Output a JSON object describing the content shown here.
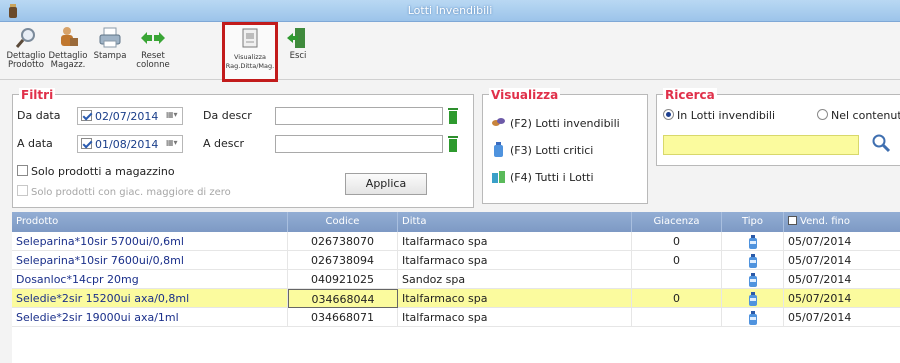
{
  "window": {
    "title": "Lotti Invendibili"
  },
  "toolbar": {
    "buttons": [
      {
        "line1": "Dettaglio",
        "line2": "Prodotto",
        "icon": "search-magnifier-icon"
      },
      {
        "line1": "Dettaglio",
        "line2": "Magazz.",
        "icon": "warehouse-worker-icon"
      },
      {
        "line1": "Stampa",
        "line2": "",
        "icon": "printer-icon"
      },
      {
        "line1": "Reset",
        "line2": "colonne",
        "icon": "reset-arrows-icon"
      },
      {
        "line1": "Visualizza",
        "line2": "Rag.Ditta/Mag.",
        "icon": "view-document-icon"
      },
      {
        "line1": "Esci",
        "line2": "",
        "icon": "exit-door-icon"
      }
    ]
  },
  "filtri": {
    "title": "Filtri",
    "da_data_label": "Da data",
    "da_data_value": "02/07/2014",
    "a_data_label": "A data",
    "a_data_value": "01/08/2014",
    "da_descr_label": "Da descr",
    "a_descr_label": "A descr",
    "solo_magazzino": "Solo prodotti a magazzino",
    "solo_giacenza": "Solo prodotti con giac. maggiore di zero",
    "applica": "Applica"
  },
  "visualizza": {
    "title": "Visualizza",
    "items": [
      {
        "label": "(F2) Lotti invendibili",
        "icon": "pills-icon"
      },
      {
        "label": "(F3) Lotti critici",
        "icon": "bottle-icon"
      },
      {
        "label": "(F4) Tutti i Lotti",
        "icon": "medicines-icon"
      }
    ]
  },
  "ricerca": {
    "title": "Ricerca",
    "option1": "In Lotti invendibili",
    "option2": "Nel contenuto",
    "search_value": ""
  },
  "grid": {
    "columns": [
      "Prodotto",
      "Codice",
      "Ditta",
      "Giacenza",
      "Tipo",
      "Vend. fino"
    ],
    "rows": [
      {
        "prodotto": "Seleparina*10sir 5700ui/0,6ml",
        "codice": "026738070",
        "ditta": "Italfarmaco spa",
        "giacenza": "0",
        "vend": "05/07/2014",
        "selected": false
      },
      {
        "prodotto": "Seleparina*10sir 7600ui/0,8ml",
        "codice": "026738094",
        "ditta": "Italfarmaco spa",
        "giacenza": "0",
        "vend": "05/07/2014",
        "selected": false
      },
      {
        "prodotto": "Dosanloc*14cpr 20mg",
        "codice": "040921025",
        "ditta": "Sandoz spa",
        "giacenza": "",
        "vend": "05/07/2014",
        "selected": false
      },
      {
        "prodotto": "Seledie*2sir 15200ui axa/0,8ml",
        "codice": "034668044",
        "ditta": "Italfarmaco spa",
        "giacenza": "0",
        "vend": "05/07/2014",
        "selected": true
      },
      {
        "prodotto": "Seledie*2sir 19000ui axa/1ml",
        "codice": "034668071",
        "ditta": "Italfarmaco spa",
        "giacenza": "",
        "vend": "05/07/2014",
        "selected": false
      }
    ]
  },
  "colors": {
    "accent_title": "#e0304a",
    "selection": "#fbfb9e",
    "header": "#7d99c4",
    "highlight_box": "#c21b1b"
  }
}
